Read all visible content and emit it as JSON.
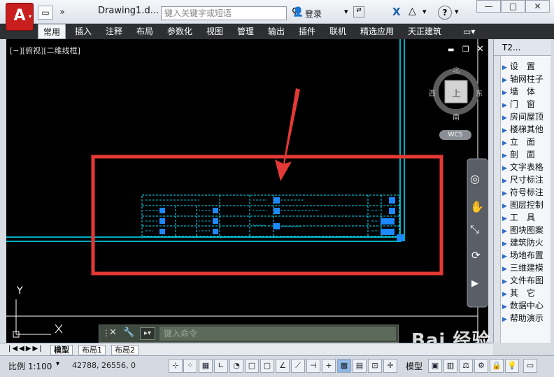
{
  "app": {
    "logo_letter": "A",
    "doc_title": "Drawing1.d...",
    "search_placeholder": "键入关键字或短语",
    "login_label": "登录",
    "window_controls": [
      "—",
      "□",
      "✕"
    ]
  },
  "ribbon": {
    "tabs": [
      "常用",
      "插入",
      "注释",
      "布局",
      "参数化",
      "视图",
      "管理",
      "输出",
      "插件",
      "联机",
      "精选应用",
      "天正建筑"
    ]
  },
  "viewport": {
    "label": "[−][俯视][二维线框]",
    "viewcube": {
      "north": "北",
      "south": "南",
      "east": "东",
      "west": "西",
      "face": "上",
      "wcs": "WCS"
    },
    "ucs_y": "Y"
  },
  "palette": {
    "title": "T2...",
    "items": [
      "设　置",
      "轴网柱子",
      "墙　体",
      "门　窗",
      "房间屋顶",
      "楼梯其他",
      "立　面",
      "剖　面",
      "文字表格",
      "尺寸标注",
      "符号标注",
      "图层控制",
      "工　具",
      "图块图案",
      "建筑防火",
      "场地布置",
      "三维建模",
      "文件布图",
      "其　它",
      "数据中心",
      "帮助演示"
    ]
  },
  "command": {
    "placeholder": "键入命令"
  },
  "layout_tabs": [
    "模型",
    "布局1",
    "布局2"
  ],
  "status": {
    "scale": "比例 1:100",
    "coords": "42788, 26556, 0",
    "model_label": "模型"
  },
  "watermark": "Bai 经验",
  "colors": {
    "canvas": "#000000",
    "cyan": "#00e5ff",
    "highlight_red": "#e53935",
    "selection_blue": "#1e88ff"
  }
}
